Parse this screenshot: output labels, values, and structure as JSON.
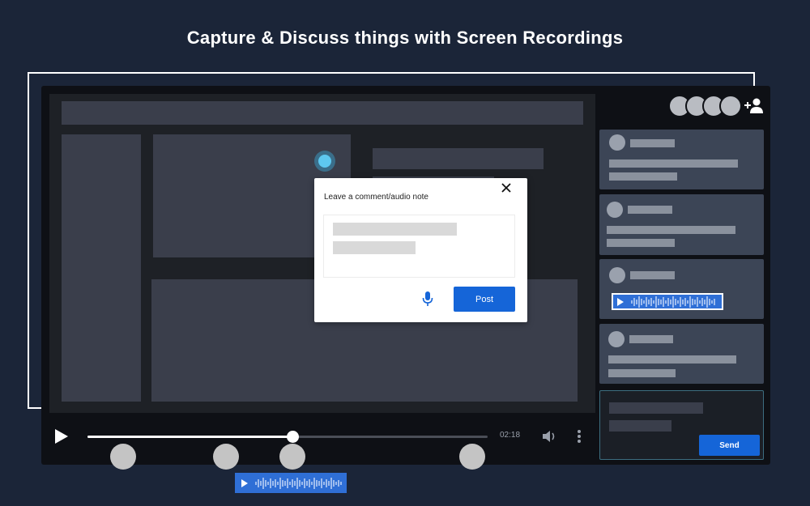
{
  "headline": "Capture & Discuss things with Screen Recordings",
  "player": {
    "time": "02:18",
    "progress_fraction": 0.51,
    "icons": [
      "play-icon",
      "volume-icon",
      "more-vertical-icon"
    ]
  },
  "collaborators": {
    "avatar_count": 4,
    "add_icon": "add-user-icon"
  },
  "dialog": {
    "title": "Leave a comment/audio note",
    "post_label": "Post",
    "close_icon": "close-icon",
    "mic_icon": "microphone-icon"
  },
  "compose": {
    "send_label": "Send"
  },
  "colors": {
    "background": "#1b2538",
    "accent": "#1565d8",
    "audio_chip": "#2f6fd6",
    "card": "#3c4556"
  }
}
